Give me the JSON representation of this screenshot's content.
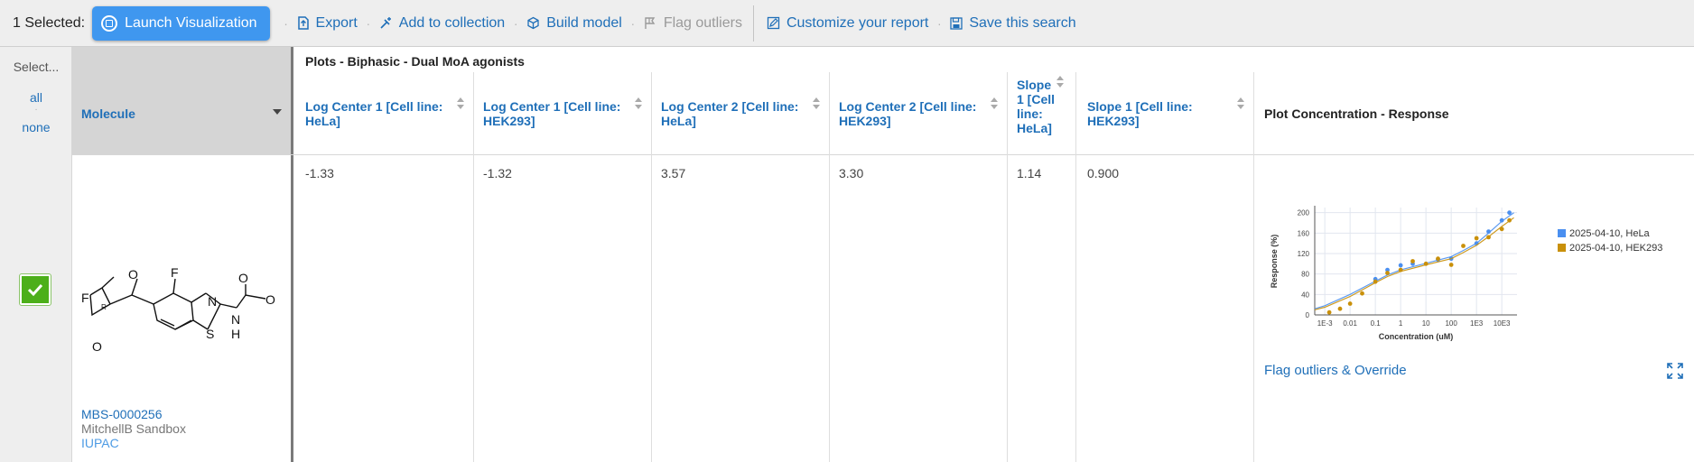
{
  "toolbar": {
    "selected_label": "1 Selected:",
    "launch_label": "Launch Visualization",
    "export_label": "Export",
    "add_collection_label": "Add to collection",
    "build_model_label": "Build model",
    "flag_outliers_label": "Flag outliers",
    "customize_label": "Customize your report",
    "save_search_label": "Save this search",
    "accent_color": "#3f97ef"
  },
  "grid": {
    "select_header": "Select...",
    "select_all": "all",
    "select_sep": "·",
    "select_none": "none",
    "molecule_header": "Molecule",
    "group_title": "Plots - Biphasic - Dual MoA agonists",
    "columns": [
      {
        "label": "Log Center 1 [Cell line: HeLa]"
      },
      {
        "label": "Log Center 1 [Cell line: HEK293]"
      },
      {
        "label": "Log Center 2 [Cell line: HeLa]"
      },
      {
        "label": "Log Center 2 [Cell line: HEK293]"
      },
      {
        "label": "Slope 1 [Cell line: HeLa]"
      },
      {
        "label": "Slope 1 [Cell line: HEK293]"
      }
    ],
    "plot_header": "Plot Concentration - Response"
  },
  "row": {
    "checked": true,
    "check_color": "#4caf1a",
    "molecule_id": "MBS-0000256",
    "project": "MitchellB Sandbox",
    "iupac_label": "IUPAC",
    "values": [
      "-1.33",
      "-1.32",
      "3.57",
      "3.30",
      "1.14",
      "0.900"
    ],
    "flag_override_label": "Flag outliers & Override"
  },
  "structure_labels": {
    "f1": "F",
    "o_carbonyl": "O",
    "f2": "F",
    "n_ring": "N",
    "o_carb": "O",
    "o_ring": "O",
    "s": "S",
    "nh_n": "N",
    "nh_h": "H",
    "o_methyl": "O",
    "stereo": "R"
  },
  "chart_data": {
    "type": "scatter",
    "xlabel": "Concentration (uM)",
    "ylabel": "Response (%)",
    "x_scale": "log",
    "xlim": [
      0.0004,
      40000
    ],
    "ylim": [
      0,
      210
    ],
    "x_ticks": [
      {
        "value": 0.001,
        "label": "1E-3"
      },
      {
        "value": 0.01,
        "label": "0.01"
      },
      {
        "value": 0.1,
        "label": "0.1"
      },
      {
        "value": 1,
        "label": "1"
      },
      {
        "value": 10,
        "label": "10"
      },
      {
        "value": 100,
        "label": "100"
      },
      {
        "value": 1000,
        "label": "1E3"
      },
      {
        "value": 10000,
        "label": "10E3"
      }
    ],
    "y_ticks": [
      0,
      40,
      80,
      120,
      160,
      200
    ],
    "grid": true,
    "legend_position": "right",
    "series": [
      {
        "name": "2025-04-10, HeLa",
        "color": "#4a8ff0",
        "points": [
          [
            0.1,
            70
          ],
          [
            0.3,
            88
          ],
          [
            1,
            97
          ],
          [
            3,
            100
          ],
          [
            30,
            108
          ],
          [
            100,
            110
          ],
          [
            1000,
            140
          ],
          [
            3000,
            163
          ],
          [
            10000,
            185
          ],
          [
            20000,
            200
          ]
        ],
        "curve": [
          [
            0.0004,
            12
          ],
          [
            0.001,
            18
          ],
          [
            0.01,
            40
          ],
          [
            0.1,
            66
          ],
          [
            0.3,
            78
          ],
          [
            1,
            88
          ],
          [
            10,
            101
          ],
          [
            100,
            114
          ],
          [
            300,
            126
          ],
          [
            1000,
            140
          ],
          [
            3000,
            160
          ],
          [
            10000,
            183
          ],
          [
            30000,
            200
          ]
        ]
      },
      {
        "name": "2025-04-10, HEK293",
        "color": "#c9900a",
        "points": [
          [
            0.0015,
            5
          ],
          [
            0.004,
            12
          ],
          [
            0.01,
            22
          ],
          [
            0.03,
            42
          ],
          [
            0.1,
            65
          ],
          [
            0.3,
            82
          ],
          [
            1,
            88
          ],
          [
            3,
            105
          ],
          [
            10,
            100
          ],
          [
            30,
            110
          ],
          [
            100,
            98
          ],
          [
            300,
            135
          ],
          [
            1000,
            150
          ],
          [
            3000,
            152
          ],
          [
            10000,
            168
          ],
          [
            20000,
            185
          ]
        ],
        "curve": [
          [
            0.0004,
            10
          ],
          [
            0.001,
            15
          ],
          [
            0.01,
            36
          ],
          [
            0.1,
            63
          ],
          [
            0.3,
            75
          ],
          [
            1,
            85
          ],
          [
            10,
            98
          ],
          [
            100,
            110
          ],
          [
            300,
            122
          ],
          [
            1000,
            136
          ],
          [
            3000,
            153
          ],
          [
            10000,
            173
          ],
          [
            30000,
            190
          ]
        ]
      }
    ]
  }
}
